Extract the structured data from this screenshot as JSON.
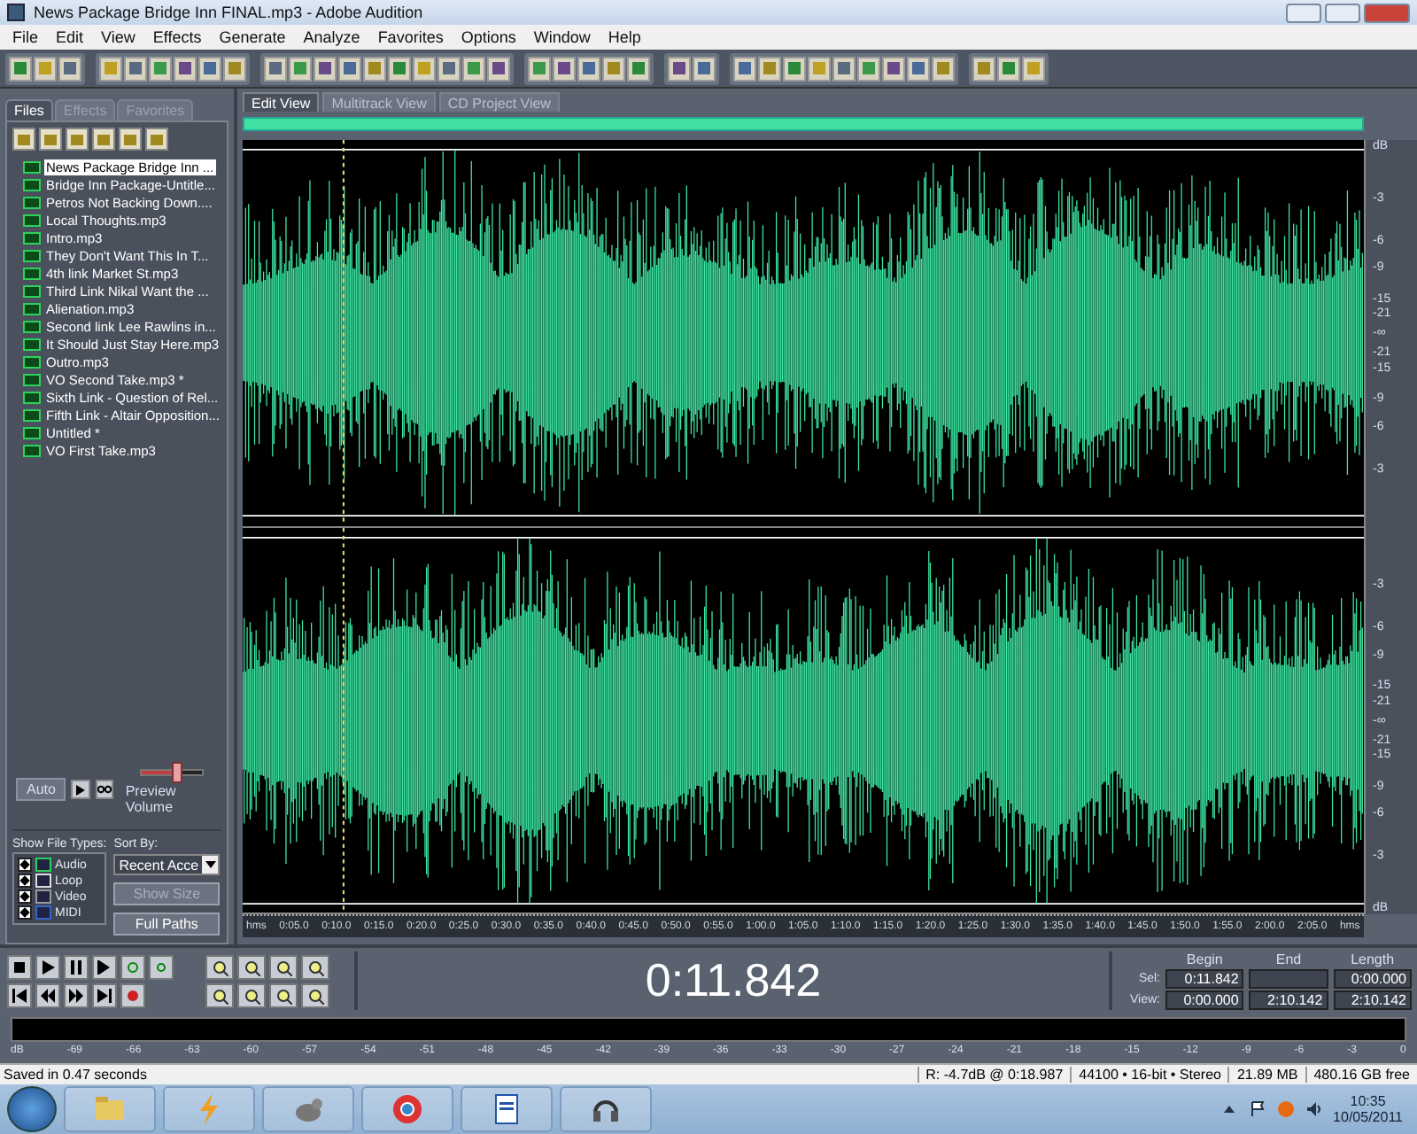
{
  "window": {
    "title": "News Package Bridge Inn FINAL.mp3 - Adobe Audition"
  },
  "menu": [
    "File",
    "Edit",
    "View",
    "Effects",
    "Generate",
    "Analyze",
    "Favorites",
    "Options",
    "Window",
    "Help"
  ],
  "organizer": {
    "tabs": [
      {
        "label": "Files",
        "selected": true
      },
      {
        "label": "Effects",
        "selected": false
      },
      {
        "label": "Favorites",
        "selected": false
      }
    ],
    "files": [
      {
        "name": "News Package Bridge Inn ...",
        "selected": true
      },
      {
        "name": "Bridge Inn Package-Untitle...",
        "selected": false
      },
      {
        "name": "Petros Not Backing Down....",
        "selected": false
      },
      {
        "name": "Local Thoughts.mp3",
        "selected": false
      },
      {
        "name": "Intro.mp3",
        "selected": false
      },
      {
        "name": "They Don't Want This In T...",
        "selected": false
      },
      {
        "name": "4th link Market St.mp3",
        "selected": false
      },
      {
        "name": "Third Link Nikal Want the ...",
        "selected": false
      },
      {
        "name": "Alienation.mp3",
        "selected": false
      },
      {
        "name": "Second link Lee Rawlins in...",
        "selected": false
      },
      {
        "name": "It Should Just Stay Here.mp3",
        "selected": false
      },
      {
        "name": "Outro.mp3",
        "selected": false
      },
      {
        "name": "VO Second Take.mp3 *",
        "selected": false
      },
      {
        "name": "Sixth Link - Question of Rel...",
        "selected": false
      },
      {
        "name": "Fifth Link - Altair Opposition...",
        "selected": false
      },
      {
        "name": "Untitled *",
        "selected": false
      },
      {
        "name": "VO First Take.mp3",
        "selected": false
      }
    ],
    "auto_button": "Auto",
    "preview_volume": {
      "label": "Preview Volume",
      "level": 0.6
    },
    "show_file_types": {
      "label": "Show File Types:",
      "types": [
        {
          "label": "Audio",
          "checked": true
        },
        {
          "label": "Loop",
          "checked": true
        },
        {
          "label": "Video",
          "checked": true
        },
        {
          "label": "MIDI",
          "checked": true
        }
      ]
    },
    "sort_by": {
      "label": "Sort By:",
      "value": "Recent Acce"
    },
    "buttons": [
      {
        "label": "Show Size",
        "disabled": true
      },
      {
        "label": "Full Paths",
        "disabled": false
      }
    ]
  },
  "view_tabs": [
    {
      "label": "Edit View",
      "selected": true
    },
    {
      "label": "Multitrack View",
      "selected": false
    },
    {
      "label": "CD Project View",
      "selected": false
    }
  ],
  "waveform": {
    "channels": [
      {
        "unit": "dB",
        "scale": [
          "-3",
          "-6",
          "-9",
          "-15",
          "-21",
          "-∞",
          "-21",
          "-15",
          "-9",
          "-6",
          "-3"
        ]
      },
      {
        "unit": "dB",
        "scale": [
          "-3",
          "-6",
          "-9",
          "-15",
          "-21",
          "-∞",
          "-21",
          "-15",
          "-9",
          "-6",
          "-3"
        ]
      }
    ],
    "ruler": [
      "hms",
      "0:05.0",
      "0:10.0",
      "0:15.0",
      "0:20.0",
      "0:25.0",
      "0:30.0",
      "0:35.0",
      "0:40.0",
      "0:45.0",
      "0:50.0",
      "0:55.0",
      "1:00.0",
      "1:05.0",
      "1:10.0",
      "1:15.0",
      "1:20.0",
      "1:25.0",
      "1:30.0",
      "1:35.0",
      "1:40.0",
      "1:45.0",
      "1:50.0",
      "1:55.0",
      "2:00.0",
      "2:05.0",
      "hms"
    ]
  },
  "time_display": "0:11.842",
  "selection": {
    "columns": [
      "Begin",
      "End",
      "Length"
    ],
    "rows": [
      {
        "label": "Sel:",
        "begin": "0:11.842",
        "length": "0:00.000"
      },
      {
        "label": "View:",
        "begin": "0:00.000",
        "end": "2:10.142",
        "length": "2:10.142"
      }
    ]
  },
  "level_meter": [
    "dB",
    "-69",
    "-66",
    "-63",
    "-60",
    "-57",
    "-54",
    "-51",
    "-48",
    "-45",
    "-42",
    "-39",
    "-36",
    "-33",
    "-30",
    "-27",
    "-24",
    "-21",
    "-18",
    "-15",
    "-12",
    "-9",
    "-6",
    "-3",
    "0"
  ],
  "status_bar": {
    "message": "Saved in 0.47 seconds",
    "fields": [
      "R: -4.7dB @  0:18.987",
      "44100 • 16-bit • Stereo",
      "21.89 MB",
      "480.16 GB free"
    ]
  },
  "taskbar": {
    "time": "10:35",
    "date": "10/05/2011"
  }
}
